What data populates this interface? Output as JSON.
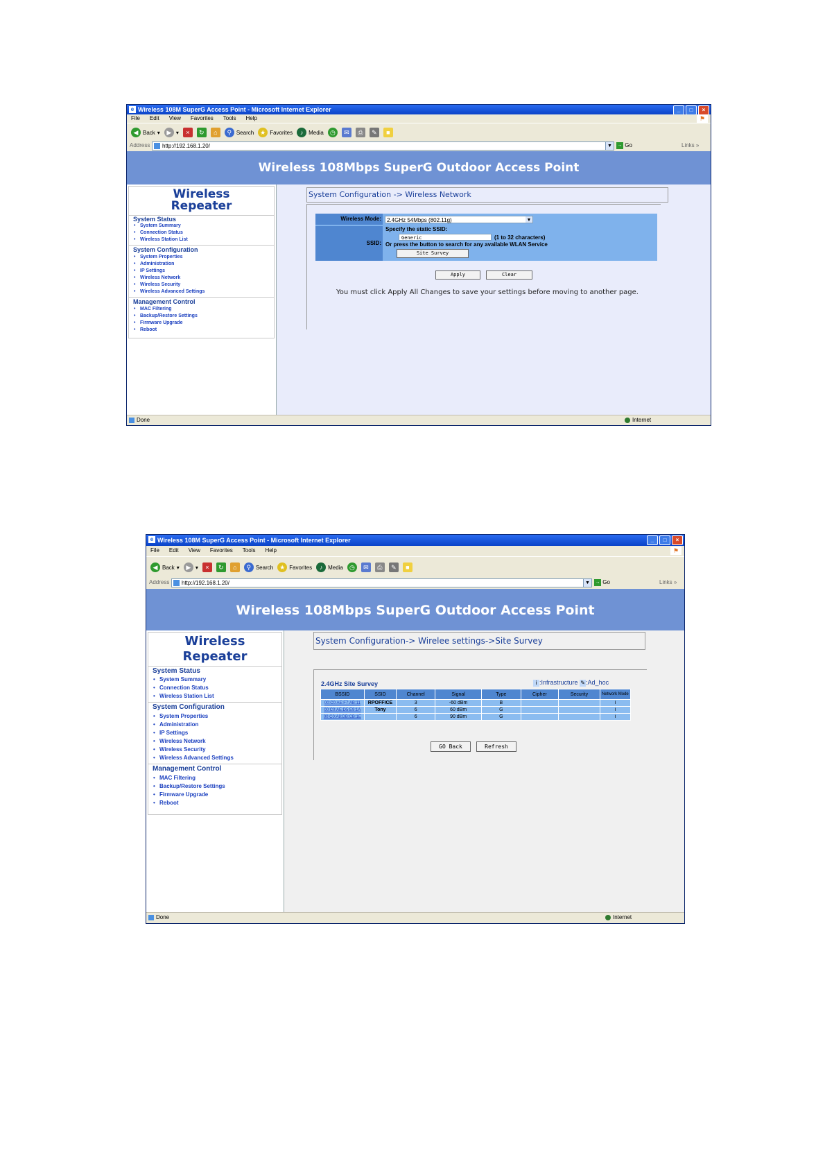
{
  "window1": {
    "title": "Wireless 108M SuperG Access Point - Microsoft Internet Explorer",
    "menu": [
      "File",
      "Edit",
      "View",
      "Favorites",
      "Tools",
      "Help"
    ],
    "toolbar": {
      "back": "Back",
      "search": "Search",
      "favorites": "Favorites",
      "media": "Media"
    },
    "address_label": "Address",
    "address": "http://192.168.1.20/",
    "go": "Go",
    "links": "Links",
    "header": "Wireless 108Mbps SuperG Outdoor Access Point",
    "brand_line1": "Wireless",
    "brand_line2": "Repeater",
    "breadcrumb": "System Configuration -> Wireless Network",
    "wireless_mode_label": "Wireless Mode:",
    "wireless_mode_value": "2.4GHz 54Mbps (802.11g)",
    "ssid_label": "SSID:",
    "ssid_specify": "Specify the static SSID:",
    "ssid_value": "Generic",
    "ssid_hint": "(1 to 32 characters)",
    "ssid_press": "Or press the button to search for any available WLAN Service",
    "site_survey_btn": "Site Survey",
    "apply_btn": "Apply",
    "clear_btn": "Clear",
    "notice": "You must click Apply All Changes to save your settings before moving to another page.",
    "status_done": "Done",
    "status_zone": "Internet"
  },
  "window2": {
    "title": "Wireless 108M SuperG Access Point - Microsoft Internet Explorer",
    "menu": [
      "File",
      "Edit",
      "View",
      "Favorites",
      "Tools",
      "Help"
    ],
    "toolbar": {
      "back": "Back",
      "search": "Search",
      "favorites": "Favorites",
      "media": "Media"
    },
    "address_label": "Address",
    "address": "http://192.168.1.20/",
    "go": "Go",
    "links": "Links",
    "header": "Wireless 108Mbps SuperG Outdoor Access Point",
    "brand_line1": "Wireless",
    "brand_line2": "Repeater",
    "breadcrumb": "System Configuration-> Wirelee settings->Site Survey",
    "survey_title": "2.4GHz Site Survey",
    "legend_infra": ":Infrastructure",
    "legend_adhoc": ":Ad_hoc",
    "columns": [
      "BSSID",
      "SSID",
      "Channel",
      "Signal",
      "Type",
      "Cipher",
      "Security",
      "Network Mode"
    ],
    "rows": [
      [
        "00:C0:AE:F7:AB:11",
        "RPOFFICE",
        "3",
        "-60 dBm",
        "B",
        "",
        "",
        "i"
      ],
      [
        "00:C0:AE:D5:E9:1A",
        "Tony",
        "6",
        "60 dBm",
        "G",
        "",
        "",
        "i"
      ],
      [
        "00:C0:A8:DB:CB:1E",
        "",
        "6",
        "90 dBm",
        "G",
        "",
        "",
        "i"
      ]
    ],
    "go_back_btn": "GO Back",
    "refresh_btn": "Refresh",
    "status_done": "Done",
    "status_zone": "Internet"
  },
  "sidebar": {
    "system_status": "System Status",
    "status_items": [
      "System Summary",
      "Connection Status",
      "Wireless Station List"
    ],
    "system_configuration": "System Configuration",
    "config_items": [
      "System Properties",
      "Administration",
      "IP Settings",
      "Wireless Network",
      "Wireless Security",
      "Wireless Advanced Settings"
    ],
    "management_control": "Management Control",
    "mgmt_items": [
      "MAC Filtering",
      "Backup/Restore Settings",
      "Firmware Upgrade",
      "Reboot"
    ]
  },
  "colors": {
    "header": "#6f92d4",
    "titlebar": "#0a43c8",
    "form": "#7fb2ec",
    "label": "#4f86d0"
  }
}
